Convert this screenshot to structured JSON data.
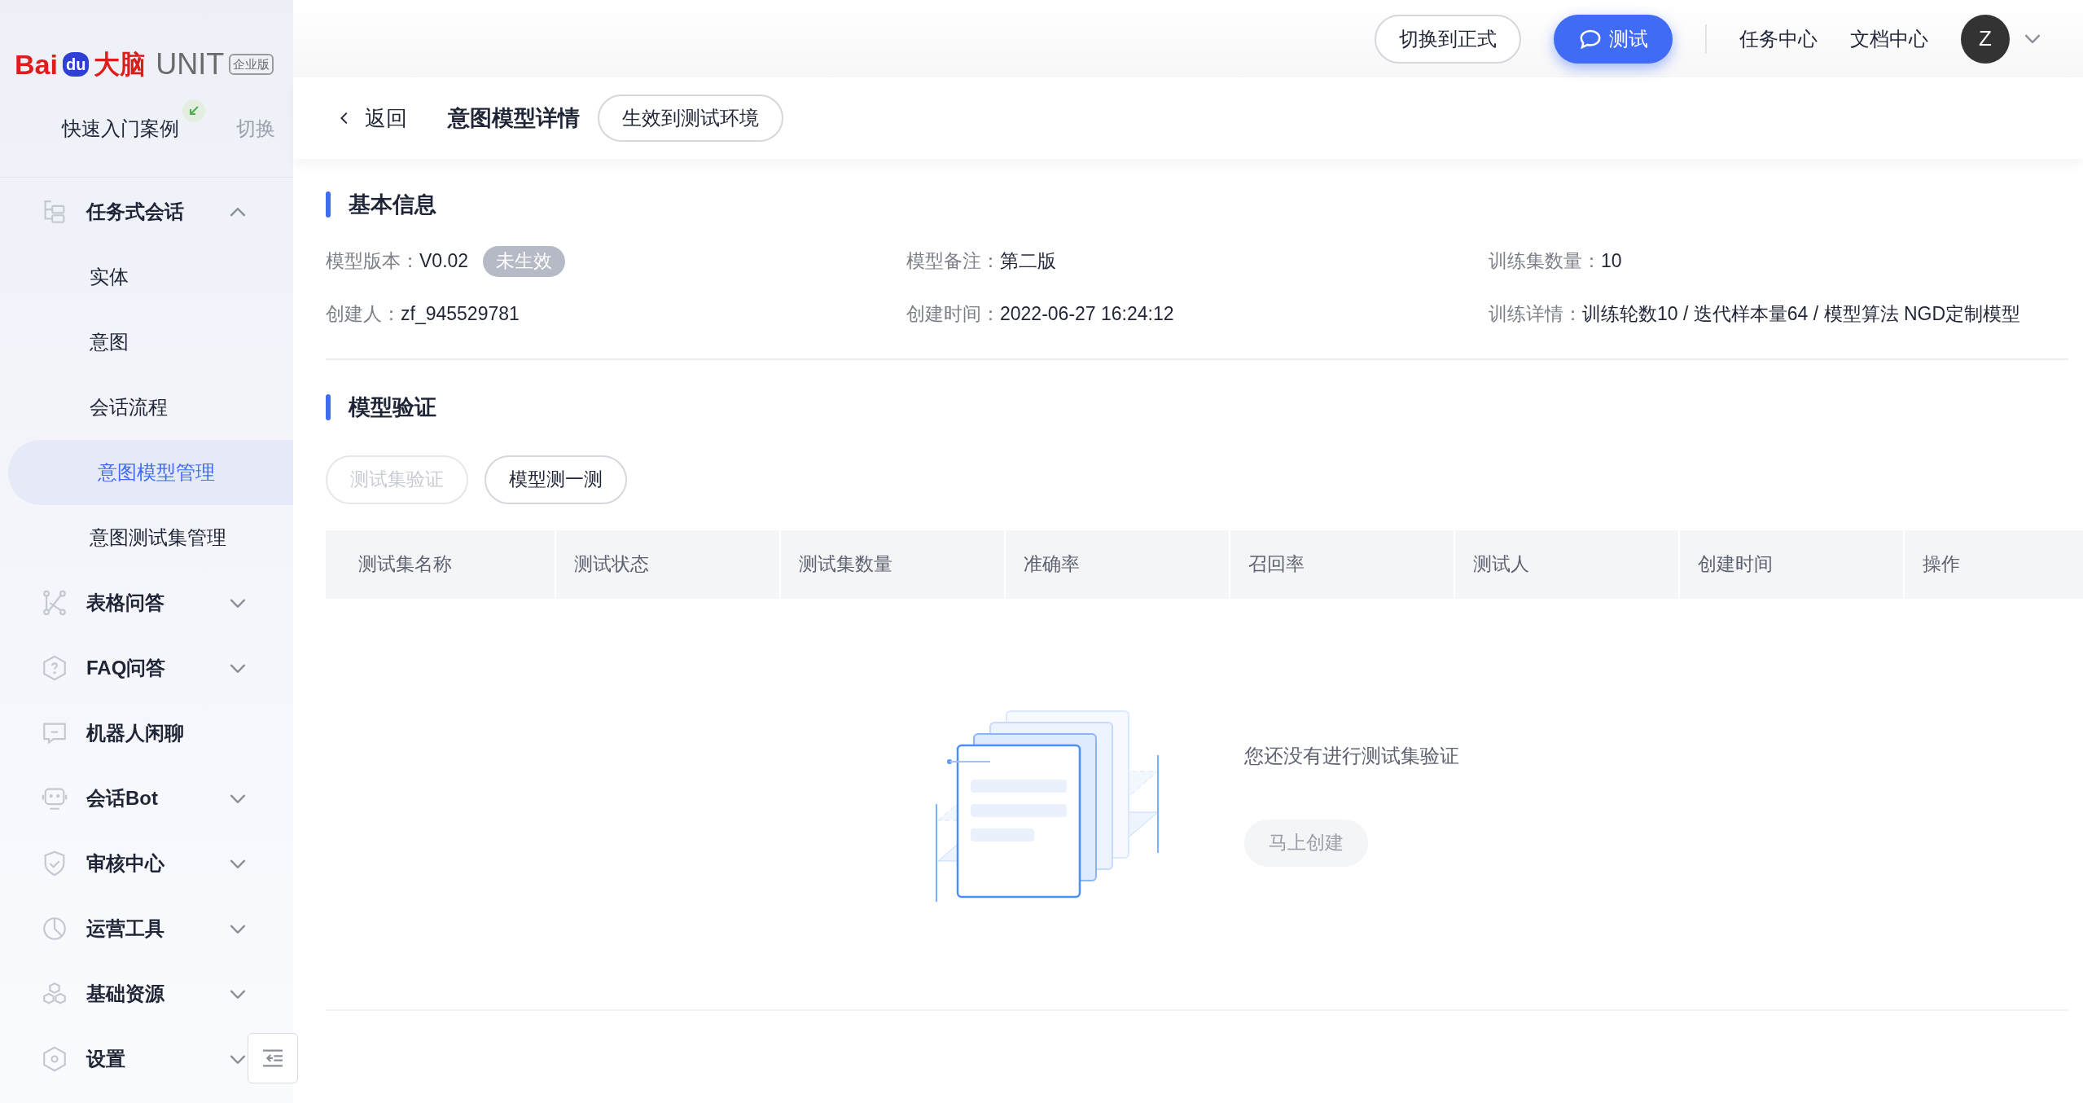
{
  "brand": {
    "logo_text": "Bai",
    "logo_du": "du",
    "logo_cn": "大脑",
    "product": "UNIT",
    "edition": "企业版"
  },
  "workspace": {
    "name": "快速入门案例",
    "switch": "切换"
  },
  "sidebar": {
    "items": [
      {
        "label": "任务式会话",
        "expanded": true,
        "children": [
          {
            "label": "实体",
            "selected": false
          },
          {
            "label": "意图",
            "selected": false
          },
          {
            "label": "会话流程",
            "selected": false
          },
          {
            "label": "意图模型管理",
            "selected": true
          },
          {
            "label": "意图测试集管理",
            "selected": false
          }
        ]
      },
      {
        "label": "表格问答",
        "expanded": false
      },
      {
        "label": "FAQ问答",
        "expanded": false
      },
      {
        "label": "机器人闲聊"
      },
      {
        "label": "会话Bot",
        "expanded": false
      },
      {
        "label": "审核中心",
        "expanded": false
      },
      {
        "label": "运营工具",
        "expanded": false
      },
      {
        "label": "基础资源",
        "expanded": false
      },
      {
        "label": "设置",
        "expanded": false
      }
    ]
  },
  "topbar": {
    "switch_button": "切换到正式",
    "test_button": "测试",
    "links": [
      "任务中心",
      "文档中心"
    ],
    "avatar": "Z"
  },
  "header": {
    "back": "返回",
    "title": "意图模型详情",
    "action": "生效到测试环境"
  },
  "basic_info": {
    "title": "基本信息",
    "fields": [
      {
        "label": "模型版本：",
        "value": "V0.02",
        "tag": "未生效"
      },
      {
        "label": "模型备注：",
        "value": "第二版"
      },
      {
        "label": "训练集数量：",
        "value": "10"
      },
      {
        "label": "创建人：",
        "value": "zf_945529781"
      },
      {
        "label": "创建时间：",
        "value": "2022-06-27 16:24:12"
      },
      {
        "label": "训练详情：",
        "value": "训练轮数10 / 迭代样本量64 / 模型算法 NGD定制模型"
      }
    ]
  },
  "validation": {
    "title": "模型验证",
    "buttons": [
      {
        "label": "测试集验证",
        "disabled": true
      },
      {
        "label": "模型测一测",
        "disabled": false
      }
    ],
    "table": {
      "columns": [
        "测试集名称",
        "测试状态",
        "测试集数量",
        "准确率",
        "召回率",
        "测试人",
        "创建时间",
        "操作"
      ]
    },
    "empty": {
      "message": "您还没有进行测试集验证",
      "button": {
        "label": "马上创建",
        "disabled": true
      }
    }
  }
}
